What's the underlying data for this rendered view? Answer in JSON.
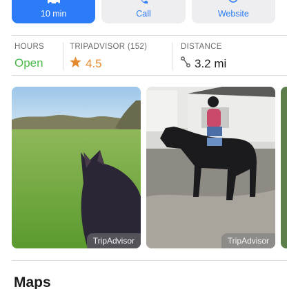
{
  "actions": [
    {
      "label": "10 min",
      "icon": "car-icon"
    },
    {
      "label": "Call",
      "icon": "phone-icon"
    },
    {
      "label": "Website",
      "icon": "globe-icon"
    }
  ],
  "info": {
    "hours_label": "HOURS",
    "hours_value": "Open",
    "tripadvisor_label": "TRIPADVISOR (152)",
    "rating_value": "4.5",
    "distance_label": "DISTANCE",
    "distance_value": "3.2 mi"
  },
  "photos": [
    {
      "credit": "TripAdvisor",
      "subject": "horse-ears-in-field-photo"
    },
    {
      "credit": "TripAdvisor",
      "subject": "rider-on-black-horse-photo"
    }
  ],
  "sections": {
    "maps_title": "Maps"
  },
  "colors": {
    "accent_blue": "#2b7cf6",
    "open_green": "#4cbb4a",
    "rating_orange": "#e58a2c"
  }
}
